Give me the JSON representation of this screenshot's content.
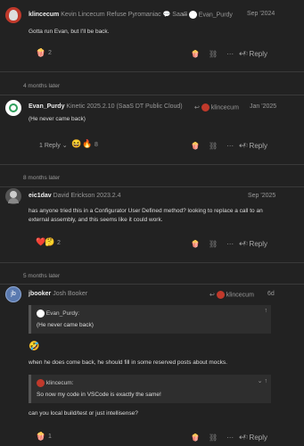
{
  "post1": {
    "username": "klincecum",
    "fullname": "Kevin Lincecum",
    "title": "Refuse Pyromaniac",
    "badge": "SaaS",
    "reply_to": "Evan_Purdy",
    "date": "Sep '2024",
    "body": "Gotta run Evan, but I'll be back.",
    "reaction_count": "2",
    "reply_label": "Reply"
  },
  "gap1": "4 months later",
  "post2": {
    "username": "Evan_Purdy",
    "title": "Kinetic 2025.2.10 (SaaS DT Public Cloud)",
    "reply_to": "klincecum",
    "date": "Jan '2025",
    "body": "(He never came back)",
    "replies_label": "1 Reply",
    "reaction_count": "8",
    "reply_label": "Reply"
  },
  "gap2": "8 months later",
  "post3": {
    "username": "eic1dav",
    "fullname": "David Erickson",
    "title": "2023.2.4",
    "date": "Sep '2025",
    "body_line1": "has anyone tried this in a Configurator User Defined method? looking to replace a call to an",
    "body_line2": "external assembly, and this seems like it could work.",
    "reaction_count": "2",
    "reply_label": "Reply"
  },
  "gap3": "5 months later",
  "post4": {
    "username": "jbooker",
    "fullname": "Josh Booker",
    "reply_to": "klincecum",
    "date": "6d",
    "quote1_author": "Evan_Purdy:",
    "quote1_body": "(He never came back)",
    "body1": "when he does come back, he should fill in some reserved posts about mocks.",
    "quote2_author": "klincecum:",
    "quote2_body": "So now my code in VSCode is exactly the same!",
    "body2": "can you local build/test or just intellisense?",
    "reaction_count": "1",
    "reply_label": "Reply"
  },
  "colors": {
    "background": "#222222",
    "accent_blue": "#4aa3df",
    "avatar_klincecum": "#c0392b",
    "avatar_evan": "#ffffff",
    "avatar_david": "#555555",
    "avatar_josh": "#5a7ab0"
  }
}
